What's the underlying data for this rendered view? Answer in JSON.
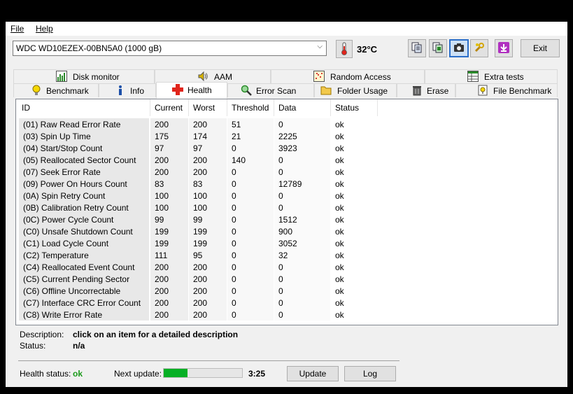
{
  "menu": {
    "file": "File",
    "help": "Help"
  },
  "drive": {
    "selected": "WDC WD10EZEX-00BN5A0 (1000 gB)"
  },
  "temperature": {
    "display": "32°C"
  },
  "toolbar": {
    "exit_label": "Exit"
  },
  "tabs_top": [
    {
      "label": "Disk monitor",
      "icon": "chart-icon"
    },
    {
      "label": "AAM",
      "icon": "speaker-icon"
    },
    {
      "label": "Random Access",
      "icon": "scatter-icon"
    },
    {
      "label": "Extra tests",
      "icon": "table-icon"
    }
  ],
  "tabs_bottom": [
    {
      "label": "Benchmark",
      "icon": "bulb-icon"
    },
    {
      "label": "Info",
      "icon": "info-icon"
    },
    {
      "label": "Health",
      "icon": "cross-icon"
    },
    {
      "label": "Error Scan",
      "icon": "magnifier-icon"
    },
    {
      "label": "Folder Usage",
      "icon": "folder-icon"
    },
    {
      "label": "Erase",
      "icon": "trash-icon"
    },
    {
      "label": "File Benchmark",
      "icon": "file-benchmark-icon"
    }
  ],
  "table": {
    "columns": [
      "ID",
      "Current",
      "Worst",
      "Threshold",
      "Data",
      "Status"
    ],
    "rows": [
      [
        "(01) Raw Read Error Rate",
        "200",
        "200",
        "51",
        "0",
        "ok"
      ],
      [
        "(03) Spin Up Time",
        "175",
        "174",
        "21",
        "2225",
        "ok"
      ],
      [
        "(04) Start/Stop Count",
        "97",
        "97",
        "0",
        "3923",
        "ok"
      ],
      [
        "(05) Reallocated Sector Count",
        "200",
        "200",
        "140",
        "0",
        "ok"
      ],
      [
        "(07) Seek Error Rate",
        "200",
        "200",
        "0",
        "0",
        "ok"
      ],
      [
        "(09) Power On Hours Count",
        "83",
        "83",
        "0",
        "12789",
        "ok"
      ],
      [
        "(0A) Spin Retry Count",
        "100",
        "100",
        "0",
        "0",
        "ok"
      ],
      [
        "(0B) Calibration Retry Count",
        "100",
        "100",
        "0",
        "0",
        "ok"
      ],
      [
        "(0C) Power Cycle Count",
        "99",
        "99",
        "0",
        "1512",
        "ok"
      ],
      [
        "(C0) Unsafe Shutdown Count",
        "199",
        "199",
        "0",
        "900",
        "ok"
      ],
      [
        "(C1) Load Cycle Count",
        "199",
        "199",
        "0",
        "3052",
        "ok"
      ],
      [
        "(C2) Temperature",
        "111",
        "95",
        "0",
        "32",
        "ok"
      ],
      [
        "(C4) Reallocated Event Count",
        "200",
        "200",
        "0",
        "0",
        "ok"
      ],
      [
        "(C5) Current Pending Sector",
        "200",
        "200",
        "0",
        "0",
        "ok"
      ],
      [
        "(C6) Offline Uncorrectable",
        "200",
        "200",
        "0",
        "0",
        "ok"
      ],
      [
        "(C7) Interface CRC Error Count",
        "200",
        "200",
        "0",
        "0",
        "ok"
      ],
      [
        "(C8) Write Error Rate",
        "200",
        "200",
        "0",
        "0",
        "ok"
      ]
    ]
  },
  "description": {
    "label": "Description:",
    "value": "click on an item for a detailed description",
    "status_label": "Status:",
    "status_value": "n/a"
  },
  "footer": {
    "health_label": "Health status:",
    "health_value": "ok",
    "next_update_label": "Next update:",
    "progress_fraction": 0.3,
    "countdown": "3:25",
    "update_button": "Update",
    "log_button": "Log"
  },
  "colors": {
    "progress": "#06b025",
    "health_ok": "#1a9a1a",
    "cross": "#e0241b"
  }
}
